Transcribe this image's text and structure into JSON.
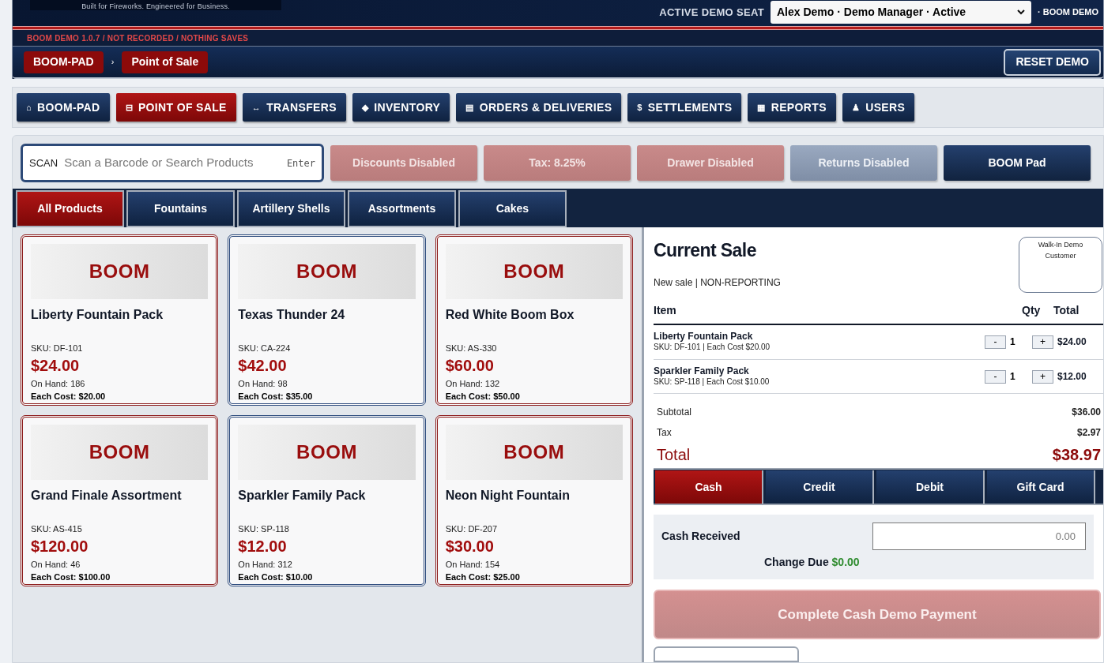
{
  "header": {
    "tagline": "Built for Fireworks. Engineered for Business.",
    "seat_label": "ACTIVE DEMO SEAT",
    "seat_value": "Alex Demo · Demo Manager · Active",
    "seat_suffix": "· BOOM DEMO"
  },
  "banner": "BOOM DEMO 1.0.7 / NOT RECORDED / NOTHING SAVES",
  "breadcrumb": {
    "items": [
      "BOOM-PAD",
      "Point of Sale"
    ],
    "separator": "›",
    "reset": "RESET DEMO"
  },
  "nav": [
    {
      "icon": "⌂",
      "label": "BOOM-PAD",
      "selected": false
    },
    {
      "icon": "⊟",
      "label": "POINT OF SALE",
      "selected": true
    },
    {
      "icon": "↔",
      "label": "TRANSFERS",
      "selected": false
    },
    {
      "icon": "◆",
      "label": "INVENTORY",
      "selected": false
    },
    {
      "icon": "▤",
      "label": "ORDERS & DELIVERIES",
      "selected": false
    },
    {
      "icon": "$",
      "label": "SETTLEMENTS",
      "selected": false
    },
    {
      "icon": "▦",
      "label": "REPORTS",
      "selected": false
    },
    {
      "icon": "♟",
      "label": "USERS",
      "selected": false
    }
  ],
  "scan": {
    "label": "SCAN",
    "placeholder": "Scan a Barcode or Search Products",
    "hint": "Enter"
  },
  "toolbar": [
    {
      "label": "Discounts Disabled",
      "kind": "red"
    },
    {
      "label": "Tax: 8.25%",
      "kind": "red"
    },
    {
      "label": "Drawer Disabled",
      "kind": "red"
    },
    {
      "label": "Returns Disabled",
      "kind": "grey"
    },
    {
      "label": "BOOM Pad",
      "kind": "navy"
    }
  ],
  "categories": [
    {
      "label": "All Products",
      "selected": true
    },
    {
      "label": "Fountains",
      "selected": false
    },
    {
      "label": "Artillery Shells",
      "selected": false
    },
    {
      "label": "Assortments",
      "selected": false
    },
    {
      "label": "Cakes",
      "selected": false
    }
  ],
  "products": [
    {
      "image_text": "BOOM",
      "name": "Liberty Fountain Pack",
      "sku": "SKU: DF-101",
      "price": "$24.00",
      "on_hand": "On Hand: 186",
      "cost": "Each Cost: $20.00",
      "color": "#8b1a1a"
    },
    {
      "image_text": "BOOM",
      "name": "Texas Thunder 24",
      "sku": "SKU: CA-224",
      "price": "$42.00",
      "on_hand": "On Hand: 98",
      "cost": "Each Cost: $35.00",
      "color": "#2c4a7c"
    },
    {
      "image_text": "BOOM",
      "name": "Red White Boom Box",
      "sku": "SKU: AS-330",
      "price": "$60.00",
      "on_hand": "On Hand: 132",
      "cost": "Each Cost: $50.00",
      "color": "#8b1a1a"
    },
    {
      "image_text": "BOOM",
      "name": "Grand Finale Assortment",
      "sku": "SKU: AS-415",
      "price": "$120.00",
      "on_hand": "On Hand: 46",
      "cost": "Each Cost: $100.00",
      "color": "#8b1a1a"
    },
    {
      "image_text": "BOOM",
      "name": "Sparkler Family Pack",
      "sku": "SKU: SP-118",
      "price": "$12.00",
      "on_hand": "On Hand: 312",
      "cost": "Each Cost: $10.00",
      "color": "#2c4a7c"
    },
    {
      "image_text": "BOOM",
      "name": "Neon Night Fountain",
      "sku": "SKU: DF-207",
      "price": "$30.00",
      "on_hand": "On Hand: 154",
      "cost": "Each Cost: $25.00",
      "color": "#8b1a1a"
    }
  ],
  "sale": {
    "title": "Current Sale",
    "subtitle": "New sale | NON-REPORTING",
    "customer": "Walk-In Demo Customer",
    "columns": [
      "Item",
      "Qty",
      "Total"
    ],
    "lines": [
      {
        "name": "Liberty Fountain Pack",
        "detail": "SKU: DF-101 | Each Cost $20.00",
        "minus": "-",
        "qty": "1",
        "plus": "+",
        "total": "$24.00"
      },
      {
        "name": "Sparkler Family Pack",
        "detail": "SKU: SP-118 | Each Cost $10.00",
        "minus": "-",
        "qty": "1",
        "plus": "+",
        "total": "$12.00"
      }
    ],
    "subtotal_label": "Subtotal",
    "subtotal": "$36.00",
    "tax_label": "Tax",
    "tax": "$2.97",
    "total_label": "Total",
    "total": "$38.97",
    "payments": [
      {
        "label": "Cash",
        "selected": true
      },
      {
        "label": "Credit",
        "selected": false
      },
      {
        "label": "Debit",
        "selected": false
      },
      {
        "label": "Gift Card",
        "selected": false
      }
    ],
    "cash_label": "Cash Received",
    "cash_placeholder": "0.00",
    "change_label": "Change Due",
    "change": "$0.00",
    "complete": {
      "label": "Complete Cash Demo Payment",
      "disabled": true
    }
  }
}
